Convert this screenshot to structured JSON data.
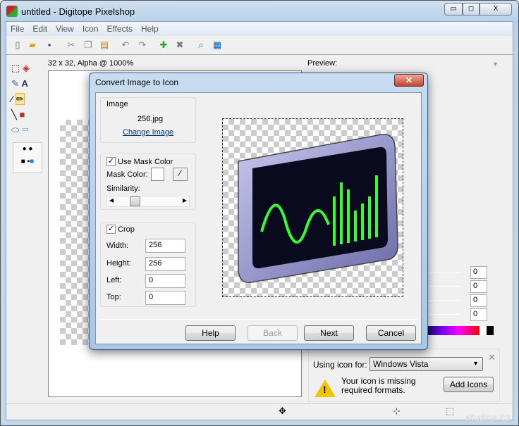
{
  "window": {
    "title": "untitled - Digitope Pixelshop",
    "minimize": "▭",
    "maximize": "◻",
    "close": "X"
  },
  "menu": [
    "File",
    "Edit",
    "View",
    "Icon",
    "Effects",
    "Help"
  ],
  "canvas": {
    "info": "32 x 32, Alpha @ 1000%"
  },
  "preview": {
    "label": "Preview:"
  },
  "dialog": {
    "title": "Convert Image to Icon",
    "close": "✕",
    "image": {
      "legend": "Image",
      "filename": "256.jpg",
      "change_link": "Change Image"
    },
    "mask": {
      "checkbox": "Use Mask Color",
      "checked": true,
      "mask_label": "Mask Color:",
      "similarity_label": "Similarity:"
    },
    "crop": {
      "checkbox": "Crop",
      "checked": true,
      "width_label": "Width:",
      "width": "256",
      "height_label": "Height:",
      "height": "256",
      "left_label": "Left:",
      "left": "0",
      "top_label": "Top:",
      "top": "0"
    },
    "buttons": {
      "help": "Help",
      "back": "Back",
      "next": "Next",
      "cancel": "Cancel"
    }
  },
  "sliders": [
    "0",
    "0",
    "0",
    "0"
  ],
  "notice": {
    "using_label": "Using icon for:",
    "platform": "Windows Vista",
    "message": "Your icon is missing required formats.",
    "add_icons": "Add Icons",
    "close": "✕"
  },
  "watermark": "studna.cz"
}
